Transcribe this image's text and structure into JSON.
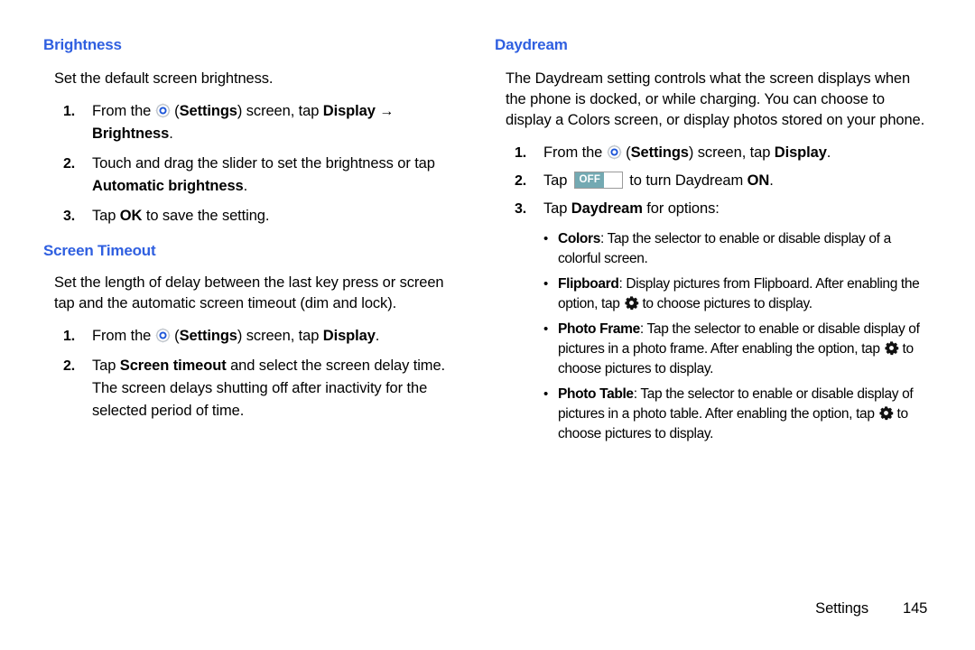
{
  "document": {
    "footer": {
      "section_label": "Settings",
      "page_number": "145"
    },
    "heading_color": "#2f5fe0",
    "toggle_color": "#73a9b2"
  },
  "left_column": {
    "brightness": {
      "heading": "Brightness",
      "intro": "Set the default screen brightness.",
      "steps": [
        {
          "number": "1.",
          "pre_icon": "From the ",
          "icon": "settings-icon",
          "post_icon_1": " (",
          "bold_1": "Settings",
          "post_icon_2": ") screen, tap ",
          "bold_2": "Display",
          "arrow": "→",
          "bold_3": "Brightness",
          "tail": "."
        },
        {
          "number": "2.",
          "text_1": "Touch and drag the slider to set the brightness or tap ",
          "bold_1": "Automatic brightness",
          "tail": "."
        },
        {
          "number": "3.",
          "text_1": "Tap ",
          "bold_1": "OK",
          "tail": " to save the setting."
        }
      ]
    },
    "screen_timeout": {
      "heading": "Screen Timeout",
      "intro": "Set the length of delay between the last key press or screen tap and the automatic screen timeout (dim and lock).",
      "steps": [
        {
          "number": "1.",
          "pre_icon": "From the ",
          "icon": "settings-icon",
          "post_icon_1": " (",
          "bold_1": "Settings",
          "post_icon_2": ") screen, tap ",
          "bold_2": "Display",
          "tail": "."
        },
        {
          "number": "2.",
          "text_1": "Tap ",
          "bold_1": "Screen timeout",
          "text_2": " and select the screen delay time. The screen delays shutting off after inactivity for the selected period of time."
        }
      ]
    }
  },
  "right_column": {
    "daydream": {
      "heading": "Daydream",
      "intro": "The Daydream setting controls what the screen displays when the phone is docked, or while charging. You can choose to display a Colors screen, or display photos stored on your phone.",
      "steps": [
        {
          "number": "1.",
          "pre_icon": "From the ",
          "icon": "settings-icon",
          "post_icon_1": " (",
          "bold_1": "Settings",
          "post_icon_2": ") screen, tap ",
          "bold_2": "Display",
          "tail": "."
        },
        {
          "number": "2.",
          "text_1": "Tap ",
          "toggle_label": "OFF",
          "text_2": " to turn Daydream ",
          "bold_1": "ON",
          "tail": "."
        },
        {
          "number": "3.",
          "text_1": "Tap ",
          "bold_1": "Daydream",
          "tail": " for options:"
        }
      ],
      "options": [
        {
          "bullet": "•",
          "term": "Colors",
          "text_1": ": Tap the selector to enable or disable display of a colorful screen."
        },
        {
          "bullet": "•",
          "term": "Flipboard",
          "text_1": ": Display pictures from Flipboard. After enabling the option, tap ",
          "icon": "gear-icon",
          "text_2": " to choose pictures to display."
        },
        {
          "bullet": "•",
          "term": "Photo Frame",
          "text_1": ": Tap the selector to enable or disable display of pictures in a photo frame. After enabling the option, tap ",
          "icon": "gear-icon",
          "text_2": " to choose pictures to display."
        },
        {
          "bullet": "•",
          "term": "Photo Table",
          "text_1": ": Tap the selector to enable or disable display of pictures in a photo table. After enabling the option, tap ",
          "icon": "gear-icon",
          "text_2": " to choose pictures to display."
        }
      ]
    }
  }
}
